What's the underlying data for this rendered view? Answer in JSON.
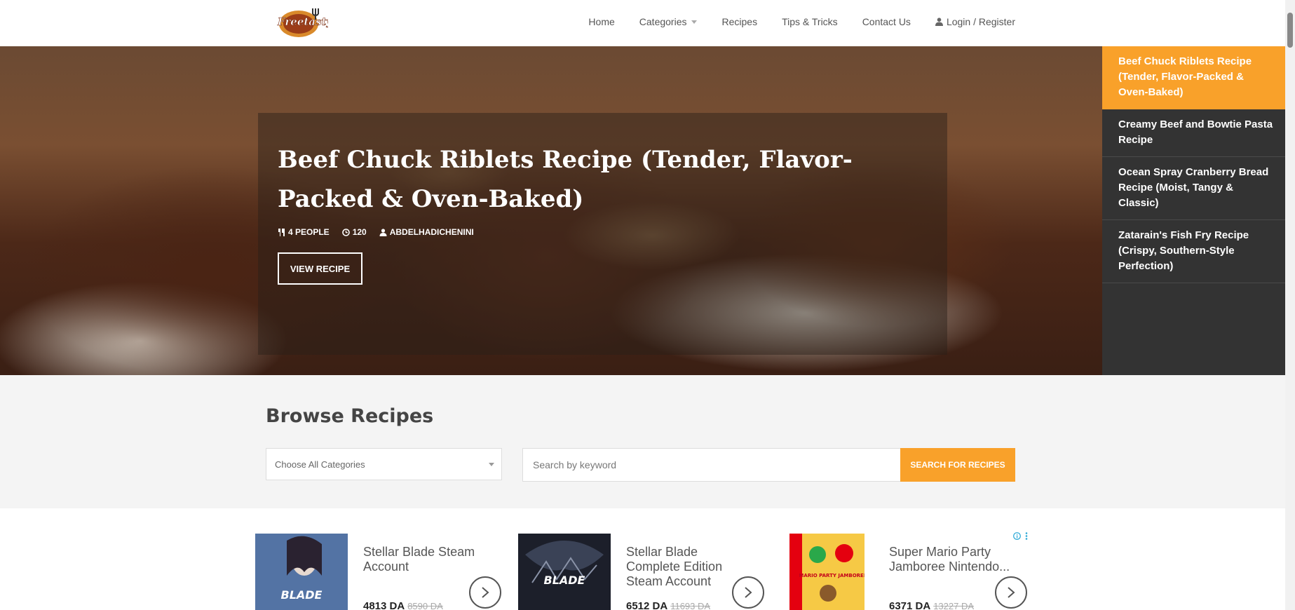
{
  "header": {
    "logo_text": "Freetasty",
    "nav": [
      {
        "label": "Home"
      },
      {
        "label": "Categories"
      },
      {
        "label": "Recipes"
      },
      {
        "label": "Tips & Tricks"
      },
      {
        "label": "Contact Us"
      },
      {
        "label": "Login / Register"
      }
    ]
  },
  "hero": {
    "title": "Beef Chuck Riblets Recipe (Tender, Flavor-Packed & Oven-Baked)",
    "people": "4 PEOPLE",
    "time": "120",
    "author": "ABDELHADICHENINI",
    "button": "VIEW RECIPE"
  },
  "side_list": [
    {
      "label": "Beef Chuck Riblets Recipe (Tender, Flavor-Packed & Oven-Baked)",
      "active": true
    },
    {
      "label": "Creamy Beef and Bowtie Pasta Recipe",
      "active": false
    },
    {
      "label": "Ocean Spray Cranberry Bread Recipe (Moist, Tangy & Classic)",
      "active": false
    },
    {
      "label": "Zatarain's Fish Fry Recipe (Crispy, Southern-Style Perfection)",
      "active": false
    }
  ],
  "browse": {
    "title": "Browse Recipes",
    "category_select": "Choose All Categories",
    "search_placeholder": "Search by keyword",
    "search_button": "SEARCH FOR RECIPES"
  },
  "ads": [
    {
      "title": "Stellar Blade Steam Account",
      "price": "4813 DA",
      "old_price": "8590 DA",
      "image_text": "BLADE"
    },
    {
      "title": "Stellar Blade Complete Edition Steam Account",
      "price": "6512 DA",
      "old_price": "11693 DA",
      "image_text": "BLADE"
    },
    {
      "title": "Super Mario Party Jamboree Nintendo...",
      "price": "6371 DA",
      "old_price": "13227 DA",
      "image_text": "MARIO PARTY JAMBOREE"
    }
  ],
  "colors": {
    "accent": "#f9a12a",
    "side_bg": "#333333",
    "browse_bg": "#f4f4f4"
  }
}
